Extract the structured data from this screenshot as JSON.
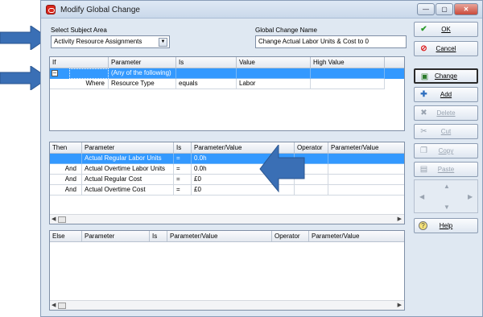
{
  "window": {
    "title": "Modify Global Change",
    "controls": {
      "min": "—",
      "max": "▢",
      "close": "✕"
    }
  },
  "subject": {
    "label": "Select Subject Area",
    "value": "Activity Resource Assignments"
  },
  "gc_name": {
    "label": "Global Change Name",
    "value": "Change Actual Labor Units & Cost to 0"
  },
  "if_grid": {
    "headers": [
      "If",
      "Parameter",
      "Is",
      "Value",
      "High Value"
    ],
    "rows": [
      {
        "prefix": "",
        "parameter": "(Any of the following)",
        "is": "",
        "value": "",
        "high": ""
      },
      {
        "prefix": "Where",
        "parameter": "Resource Type",
        "is": "equals",
        "value": "Labor",
        "high": ""
      }
    ]
  },
  "then_grid": {
    "headers": [
      "Then",
      "Parameter",
      "Is",
      "Parameter/Value",
      "Operator",
      "Parameter/Value"
    ],
    "rows": [
      {
        "op": "",
        "parameter": "Actual Regular Labor Units",
        "is": "=",
        "value": "0.0h"
      },
      {
        "op": "And",
        "parameter": "Actual Overtime Labor Units",
        "is": "=",
        "value": "0.0h"
      },
      {
        "op": "And",
        "parameter": "Actual Regular Cost",
        "is": "=",
        "value": "£0"
      },
      {
        "op": "And",
        "parameter": "Actual Overtime Cost",
        "is": "=",
        "value": "£0"
      }
    ]
  },
  "else_grid": {
    "headers": [
      "Else",
      "Parameter",
      "Is",
      "Parameter/Value",
      "Operator",
      "Parameter/Value"
    ]
  },
  "buttons": {
    "ok": "OK",
    "cancel": "Cancel",
    "change": "Change",
    "add": "Add",
    "delete": "Delete",
    "cut": "Cut",
    "copy": "Copy",
    "paste": "Paste",
    "help": "Help"
  },
  "colors": {
    "selection": "#3399ff",
    "annotation_arrow": "#3a6fb5"
  }
}
